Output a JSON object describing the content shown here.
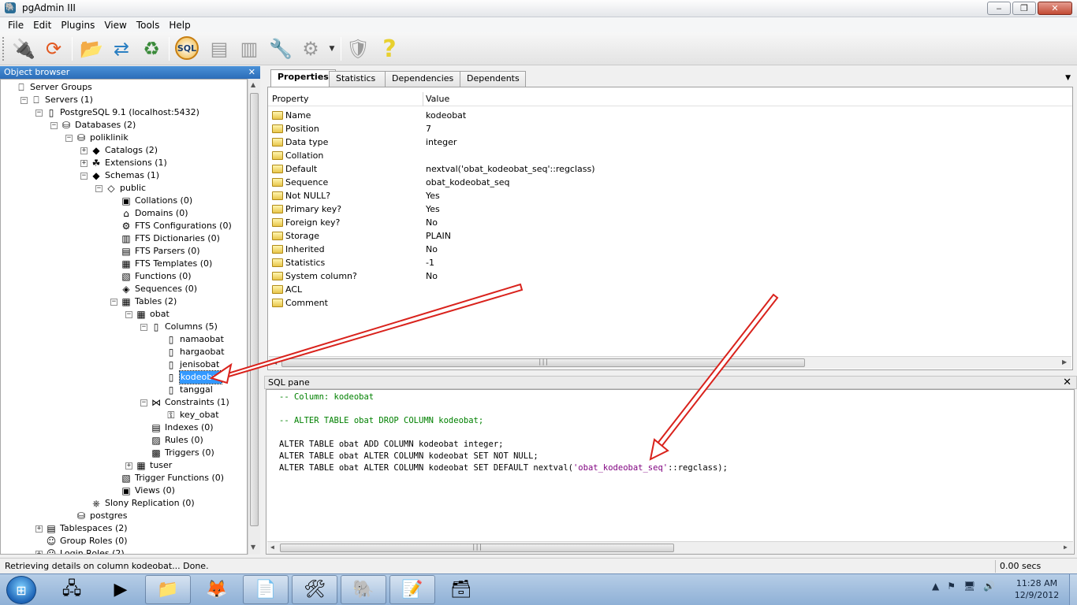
{
  "window": {
    "title": "pgAdmin III",
    "minimize": "‒",
    "maximize": "❐",
    "close": "✕"
  },
  "menu": [
    "File",
    "Edit",
    "Plugins",
    "View",
    "Tools",
    "Help"
  ],
  "toolbar": {
    "sql_label": "SQL"
  },
  "object_browser": {
    "title": "Object browser",
    "close": "✕",
    "tree": [
      {
        "label": "Server Groups",
        "icon": "server-groups-icon",
        "glyph": "⎕",
        "exp": "",
        "depth": 0
      },
      {
        "label": "Servers (1)",
        "icon": "servers-icon",
        "glyph": "⎕",
        "exp": "−",
        "depth": 1
      },
      {
        "label": "PostgreSQL 9.1 (localhost:5432)",
        "icon": "server-icon",
        "glyph": "▯",
        "exp": "−",
        "depth": 2
      },
      {
        "label": "Databases (2)",
        "icon": "databases-icon",
        "glyph": "⛁",
        "exp": "−",
        "depth": 3
      },
      {
        "label": "poliklinik",
        "icon": "database-icon",
        "glyph": "⛁",
        "exp": "−",
        "depth": 4
      },
      {
        "label": "Catalogs (2)",
        "icon": "catalogs-icon",
        "glyph": "◆",
        "exp": "+",
        "depth": 5
      },
      {
        "label": "Extensions (1)",
        "icon": "extensions-icon",
        "glyph": "☘",
        "exp": "+",
        "depth": 5
      },
      {
        "label": "Schemas (1)",
        "icon": "schemas-icon",
        "glyph": "◆",
        "exp": "−",
        "depth": 5
      },
      {
        "label": "public",
        "icon": "schema-icon",
        "glyph": "◇",
        "exp": "−",
        "depth": 6
      },
      {
        "label": "Collations (0)",
        "icon": "collations-icon",
        "glyph": "▣",
        "exp": "",
        "depth": 7
      },
      {
        "label": "Domains (0)",
        "icon": "domains-icon",
        "glyph": "⌂",
        "exp": "",
        "depth": 7
      },
      {
        "label": "FTS Configurations (0)",
        "icon": "fts-configurations-icon",
        "glyph": "⚙",
        "exp": "",
        "depth": 7
      },
      {
        "label": "FTS Dictionaries (0)",
        "icon": "fts-dictionaries-icon",
        "glyph": "▥",
        "exp": "",
        "depth": 7
      },
      {
        "label": "FTS Parsers (0)",
        "icon": "fts-parsers-icon",
        "glyph": "▤",
        "exp": "",
        "depth": 7
      },
      {
        "label": "FTS Templates (0)",
        "icon": "fts-templates-icon",
        "glyph": "▦",
        "exp": "",
        "depth": 7
      },
      {
        "label": "Functions (0)",
        "icon": "functions-icon",
        "glyph": "▧",
        "exp": "",
        "depth": 7
      },
      {
        "label": "Sequences (0)",
        "icon": "sequences-icon",
        "glyph": "◈",
        "exp": "",
        "depth": 7
      },
      {
        "label": "Tables (2)",
        "icon": "tables-icon",
        "glyph": "▦",
        "exp": "−",
        "depth": 7
      },
      {
        "label": "obat",
        "icon": "table-icon",
        "glyph": "▦",
        "exp": "−",
        "depth": 8
      },
      {
        "label": "Columns (5)",
        "icon": "columns-icon",
        "glyph": "▯",
        "exp": "−",
        "depth": 9
      },
      {
        "label": "namaobat",
        "icon": "column-icon",
        "glyph": "▯",
        "exp": "",
        "depth": 10
      },
      {
        "label": "hargaobat",
        "icon": "column-icon",
        "glyph": "▯",
        "exp": "",
        "depth": 10
      },
      {
        "label": "jenisobat",
        "icon": "column-icon",
        "glyph": "▯",
        "exp": "",
        "depth": 10
      },
      {
        "label": "kodeobat",
        "icon": "column-icon",
        "glyph": "▯",
        "exp": "",
        "depth": 10,
        "selected": true
      },
      {
        "label": "tanggal",
        "icon": "column-icon",
        "glyph": "▯",
        "exp": "",
        "depth": 10
      },
      {
        "label": "Constraints (1)",
        "icon": "constraints-icon",
        "glyph": "⋈",
        "exp": "−",
        "depth": 9
      },
      {
        "label": "key_obat",
        "icon": "primary-key-icon",
        "glyph": "⚿",
        "exp": "",
        "depth": 10
      },
      {
        "label": "Indexes (0)",
        "icon": "indexes-icon",
        "glyph": "▤",
        "exp": "",
        "depth": 9
      },
      {
        "label": "Rules (0)",
        "icon": "rules-icon",
        "glyph": "▨",
        "exp": "",
        "depth": 9
      },
      {
        "label": "Triggers (0)",
        "icon": "triggers-icon",
        "glyph": "▩",
        "exp": "",
        "depth": 9
      },
      {
        "label": "tuser",
        "icon": "table-icon",
        "glyph": "▦",
        "exp": "+",
        "depth": 8
      },
      {
        "label": "Trigger Functions (0)",
        "icon": "trigger-functions-icon",
        "glyph": "▧",
        "exp": "",
        "depth": 7
      },
      {
        "label": "Views (0)",
        "icon": "views-icon",
        "glyph": "▣",
        "exp": "",
        "depth": 7
      },
      {
        "label": "Slony Replication (0)",
        "icon": "slony-replication-icon",
        "glyph": "⎈",
        "exp": "",
        "depth": 5
      },
      {
        "label": "postgres",
        "icon": "database-icon",
        "glyph": "⛁",
        "exp": "",
        "depth": 4
      },
      {
        "label": "Tablespaces (2)",
        "icon": "tablespaces-icon",
        "glyph": "▤",
        "exp": "+",
        "depth": 2
      },
      {
        "label": "Group Roles (0)",
        "icon": "group-roles-icon",
        "glyph": "☺",
        "exp": "",
        "depth": 2
      },
      {
        "label": "Login Roles (2)",
        "icon": "login-roles-icon",
        "glyph": "☺",
        "exp": "+",
        "depth": 2
      }
    ]
  },
  "tabs": [
    "Properties",
    "Statistics",
    "Dependencies",
    "Dependents"
  ],
  "properties": {
    "headers": {
      "property": "Property",
      "value": "Value"
    },
    "rows": [
      {
        "name": "Name",
        "value": "kodeobat"
      },
      {
        "name": "Position",
        "value": "7"
      },
      {
        "name": "Data type",
        "value": "integer"
      },
      {
        "name": "Collation",
        "value": ""
      },
      {
        "name": "Default",
        "value": "nextval('obat_kodeobat_seq'::regclass)"
      },
      {
        "name": "Sequence",
        "value": "obat_kodeobat_seq"
      },
      {
        "name": "Not NULL?",
        "value": "Yes"
      },
      {
        "name": "Primary key?",
        "value": "Yes"
      },
      {
        "name": "Foreign key?",
        "value": "No"
      },
      {
        "name": "Storage",
        "value": "PLAIN"
      },
      {
        "name": "Inherited",
        "value": "No"
      },
      {
        "name": "Statistics",
        "value": "-1"
      },
      {
        "name": "System column?",
        "value": "No"
      },
      {
        "name": "ACL",
        "value": ""
      },
      {
        "name": "Comment",
        "value": ""
      }
    ]
  },
  "sql_pane": {
    "title": "SQL pane",
    "close": "✕",
    "lines": [
      {
        "text": "-- Column: kodeobat",
        "kind": "comment"
      },
      {
        "text": "",
        "kind": "blank"
      },
      {
        "text": "-- ALTER TABLE obat DROP COLUMN kodeobat;",
        "kind": "comment"
      },
      {
        "text": "",
        "kind": "blank"
      },
      {
        "text": "ALTER TABLE obat ADD COLUMN kodeobat integer;",
        "kind": "code"
      },
      {
        "text": "ALTER TABLE obat ALTER COLUMN kodeobat SET NOT NULL;",
        "kind": "code"
      },
      {
        "pre": "ALTER TABLE obat ALTER COLUMN kodeobat SET DEFAULT nextval(",
        "str": "'obat_kodeobat_seq'",
        "post": "::regclass);",
        "kind": "mixed"
      }
    ]
  },
  "status": {
    "message": "Retrieving details on column kodeobat... Done.",
    "elapsed": "0.00 secs"
  },
  "taskbar": {
    "time": "11:28 AM",
    "date": "12/9/2012"
  },
  "colors": {
    "selection": "#3399ff",
    "comment": "#008000",
    "string": "#7f007f",
    "annotation_arrow": "#d9221c"
  }
}
